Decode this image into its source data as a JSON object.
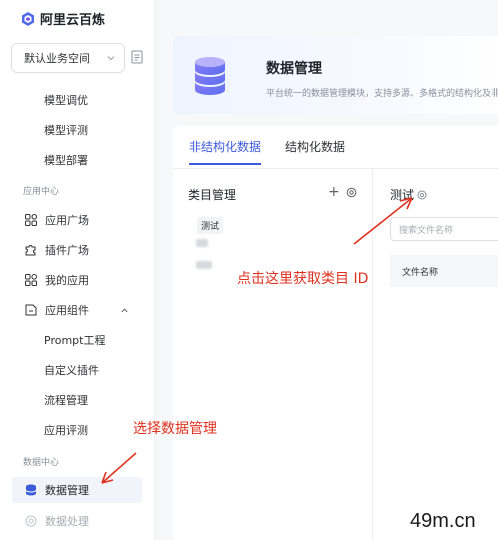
{
  "app": {
    "name": "阿里云百炼"
  },
  "workspace": {
    "label": "默认业务空间"
  },
  "sidebar": {
    "model_items": [
      {
        "label": "模型调优"
      },
      {
        "label": "模型评测"
      },
      {
        "label": "模型部署"
      }
    ],
    "app_center": {
      "section": "应用中心",
      "items": [
        {
          "label": "应用广场",
          "icon": "grid-icon"
        },
        {
          "label": "插件广场",
          "icon": "puzzle-icon"
        },
        {
          "label": "我的应用",
          "icon": "apps-icon"
        },
        {
          "label": "应用组件",
          "icon": "component-icon"
        }
      ],
      "sub_items": [
        {
          "label": "Prompt工程"
        },
        {
          "label": "自定义插件"
        },
        {
          "label": "流程管理"
        },
        {
          "label": "应用评测"
        }
      ]
    },
    "data_center": {
      "section": "数据中心",
      "items": [
        {
          "label": "数据管理",
          "icon": "database-icon",
          "active": true
        },
        {
          "label": "数据处理",
          "icon": "process-icon"
        }
      ]
    }
  },
  "header": {
    "title": "数据管理",
    "description": "平台统一的数据管理模块，支持多源、多格式的结构化及非结构"
  },
  "tabs": [
    {
      "label": "非结构化数据",
      "active": true
    },
    {
      "label": "结构化数据",
      "active": false
    }
  ],
  "category": {
    "title": "类目管理",
    "add_symbol": "+",
    "items": [
      {
        "label": "测试"
      }
    ]
  },
  "files": {
    "title": "测试",
    "search_placeholder": "搜索文件名称",
    "columns": [
      "文件名称"
    ]
  },
  "annotations": {
    "get_id": "点击这里获取类目 ID",
    "select_data": "选择数据管理",
    "color": "#e0321f"
  },
  "watermark": "49m.cn",
  "colors": {
    "accent": "#3b5bdb",
    "annotation": "#e0321f"
  }
}
